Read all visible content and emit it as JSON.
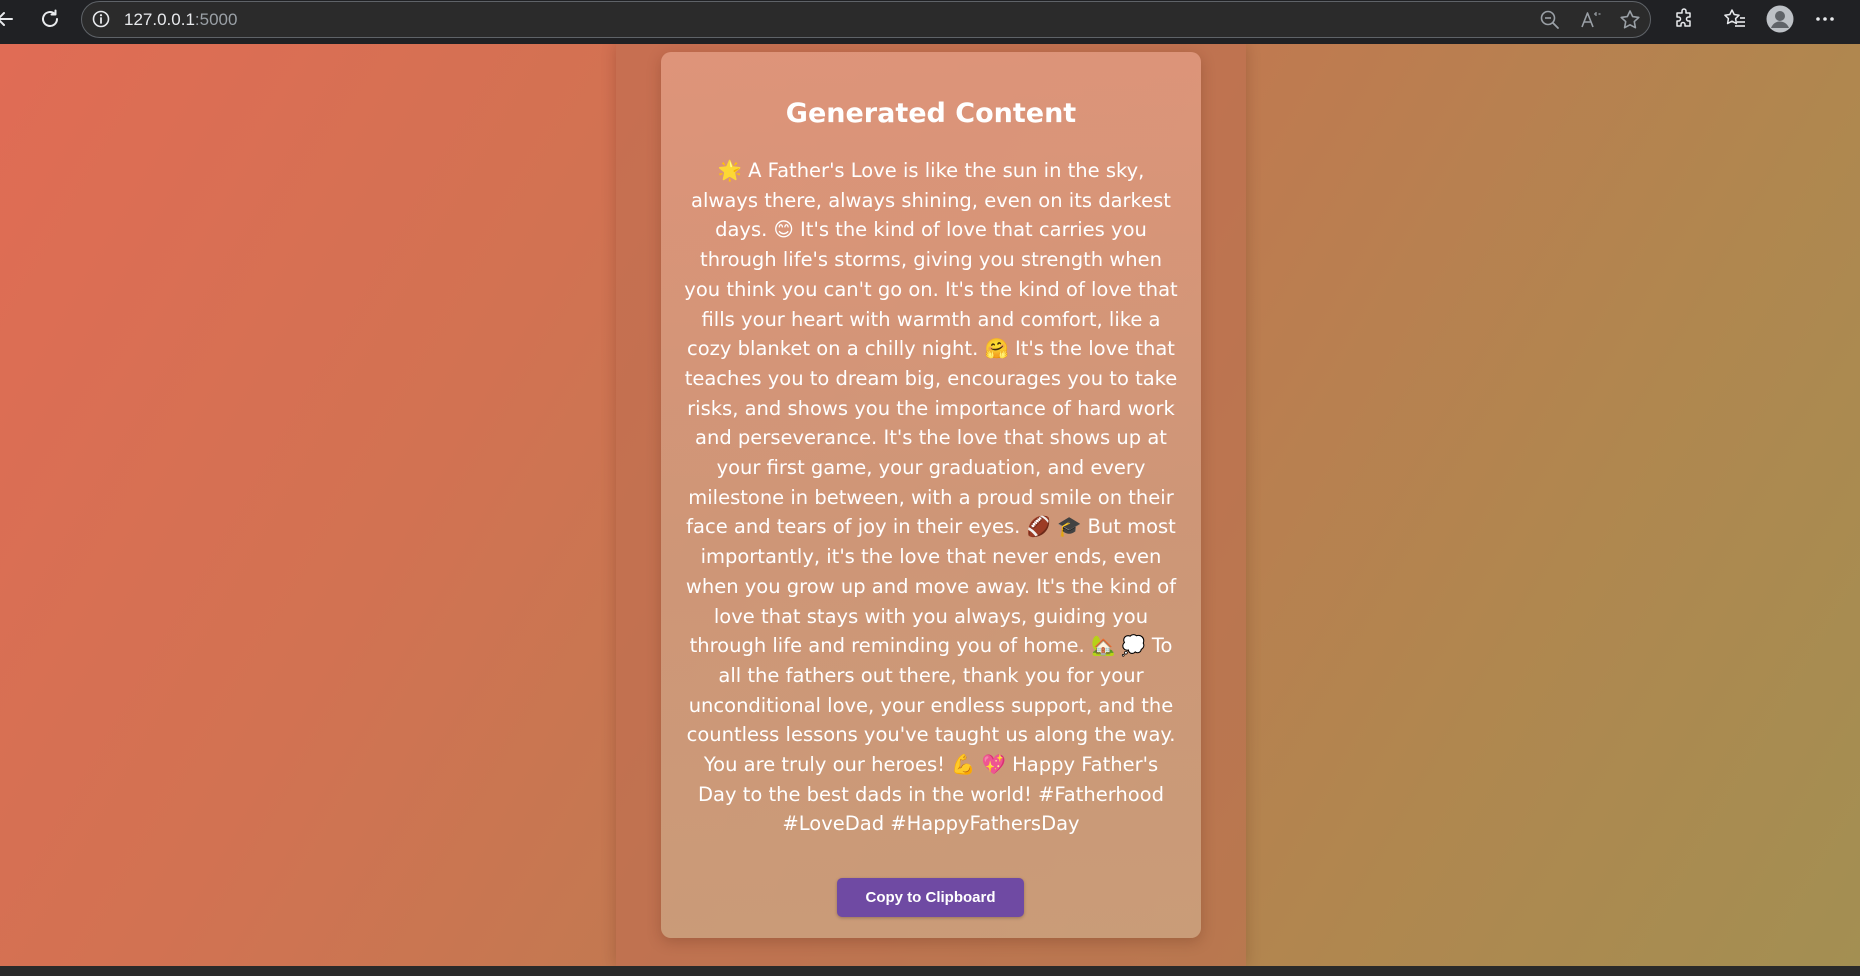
{
  "browser": {
    "url_host": "127.0.0.1",
    "url_port": ":5000",
    "icons": {
      "back": "arrow-left",
      "reload": "reload",
      "site_info": "info-circle",
      "zoom": "zoom-out",
      "read_aloud": "read-aloud",
      "favorite": "star",
      "extensions": "puzzle",
      "favorites_list": "favorites",
      "profile": "avatar",
      "menu": "ellipsis"
    }
  },
  "page": {
    "colors": {
      "background_start": "#e06c55",
      "background_end": "#a38f52",
      "button": "#6f4aa3",
      "text": "#ffffff"
    },
    "card": {
      "title": "Generated Content",
      "body": "🌟 A Father's Love is like the sun in the sky, always there, always shining, even on its darkest days. 😊 It's the kind of love that carries you through life's storms, giving you strength when you think you can't go on. It's the kind of love that fills your heart with warmth and comfort, like a cozy blanket on a chilly night. 🤗 It's the love that teaches you to dream big, encourages you to take risks, and shows you the importance of hard work and perseverance. It's the love that shows up at your first game, your graduation, and every milestone in between, with a proud smile on their face and tears of joy in their eyes. 🏈 🎓 But most importantly, it's the love that never ends, even when you grow up and move away. It's the kind of love that stays with you always, guiding you through life and reminding you of home. 🏡 💭 To all the fathers out there, thank you for your unconditional love, your endless support, and the countless lessons you've taught us along the way. You are truly our heroes! 💪 💖 Happy Father's Day to the best dads in the world! #Fatherhood #LoveDad #HappyFathersDay",
      "copy_button_label": "Copy to Clipboard"
    }
  }
}
